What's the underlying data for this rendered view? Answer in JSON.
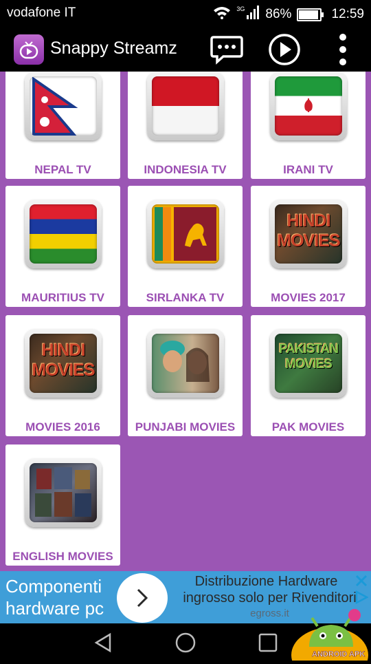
{
  "status_bar": {
    "carrier": "vodafone IT",
    "network": "3G",
    "battery": "86%",
    "battery_level": 0.86,
    "time": "12:59"
  },
  "app_bar": {
    "title": "Snappy Streamz",
    "icons": [
      "app-logo-icon",
      "chat-icon",
      "play-icon",
      "more-vert-icon"
    ]
  },
  "tiles": [
    {
      "label": "NEPAL TV"
    },
    {
      "label": "INDONESIA TV"
    },
    {
      "label": "IRANI TV"
    },
    {
      "label": "MAURITIUS TV"
    },
    {
      "label": "SIRLANKA TV"
    },
    {
      "label": "MOVIES 2017",
      "art": "HINDI MOVIES"
    },
    {
      "label": "MOVIES 2016",
      "art": "HINDI MOVIES"
    },
    {
      "label": "PUNJABI MOVIES"
    },
    {
      "label": "PAK MOVIES",
      "art": "PAKISTAN MOVIES"
    },
    {
      "label": "ENGLISH MOVIES"
    }
  ],
  "ad": {
    "left_text": "Componenti hardware pc",
    "line1": "Distribuzione Hardware",
    "line2": "ingrosso solo per Rivenditori",
    "domain": "egross.it",
    "icons": [
      "chevron-right-icon",
      "close-icon",
      "adchoices-icon"
    ]
  },
  "nav_bar": {
    "icons": [
      "back-icon",
      "home-icon",
      "recents-icon"
    ]
  },
  "watermark": "ANDROID APK"
}
